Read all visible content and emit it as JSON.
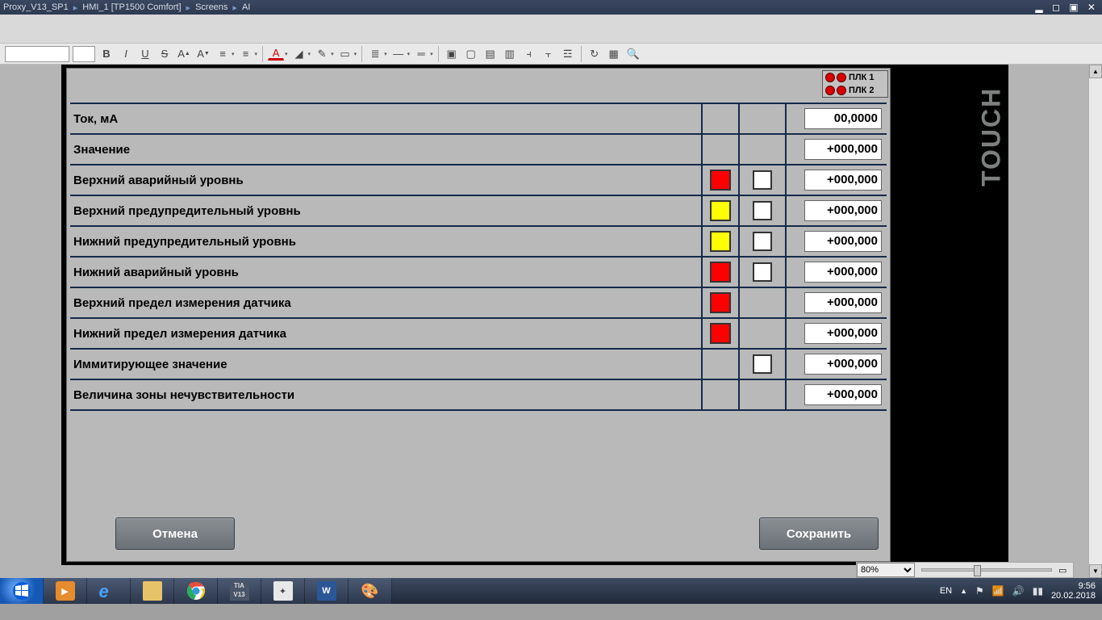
{
  "titlebar": {
    "crumbs": [
      "Proxy_V13_SP1",
      "HMI_1 [TP1500 Comfort]",
      "Screens",
      "AI"
    ]
  },
  "touch_label": "TOUCH",
  "plc": {
    "line1": "ПЛК 1",
    "line2": "ПЛК 2"
  },
  "params": [
    {
      "label": "Ток, мА",
      "indicator": null,
      "check": false,
      "value": "00,0000"
    },
    {
      "label": "Значение",
      "indicator": null,
      "check": false,
      "value": "+000,000"
    },
    {
      "label": "Верхний аварийный уровнь",
      "indicator": "red",
      "check": true,
      "value": "+000,000"
    },
    {
      "label": "Верхний предупредительный уровнь",
      "indicator": "yellow",
      "check": true,
      "value": "+000,000"
    },
    {
      "label": "Нижний предупредительный уровнь",
      "indicator": "yellow",
      "check": true,
      "value": "+000,000"
    },
    {
      "label": "Нижний аварийный уровнь",
      "indicator": "red",
      "check": true,
      "value": "+000,000"
    },
    {
      "label": "Верхний предел измерения датчика",
      "indicator": "red",
      "check": false,
      "value": "+000,000"
    },
    {
      "label": "Нижний предел измерения датчика",
      "indicator": "red",
      "check": false,
      "value": "+000,000"
    },
    {
      "label": "Иммитирующее значение",
      "indicator": null,
      "check": true,
      "value": "+000,000"
    },
    {
      "label": "Величина зоны нечувствительности",
      "indicator": null,
      "check": false,
      "value": "+000,000"
    }
  ],
  "buttons": {
    "cancel": "Отмена",
    "save": "Сохранить"
  },
  "zoom": {
    "value": "80%"
  },
  "tray": {
    "lang": "EN",
    "time": "9:56",
    "date": "20.02.2018"
  }
}
